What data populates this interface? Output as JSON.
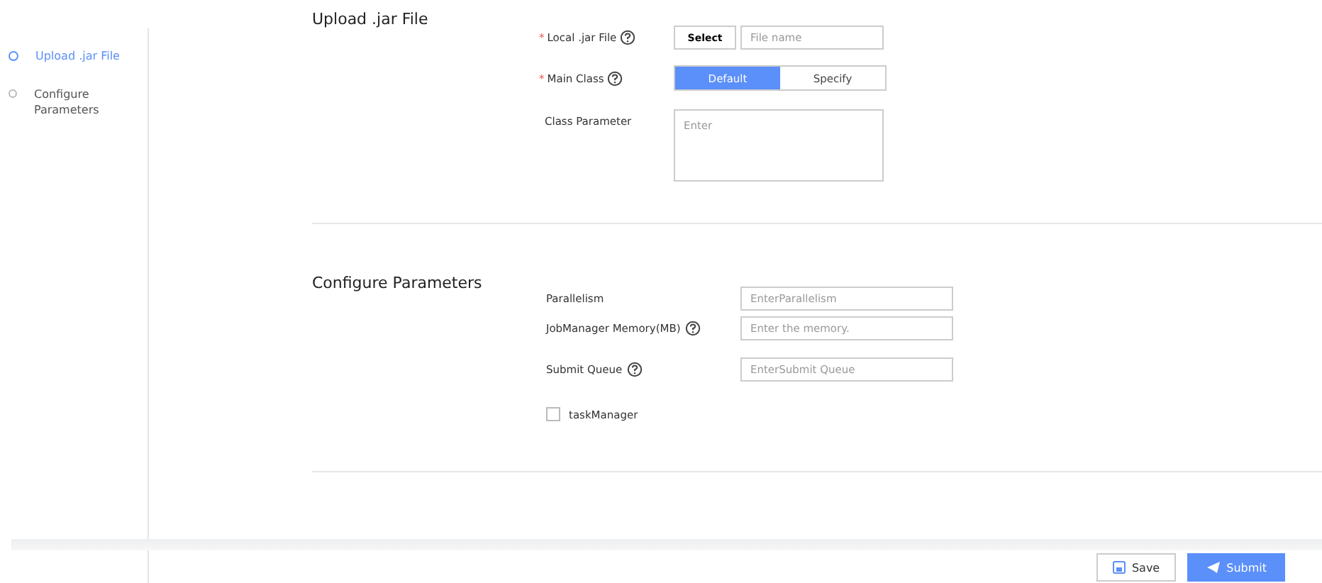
{
  "steps": [
    {
      "label": "Upload .jar File",
      "selected": true
    },
    {
      "label": "Configure Parameters",
      "selected": false
    }
  ],
  "upload": {
    "title": "Upload .jar File",
    "local_jar": {
      "mark": "*",
      "label": "Local .jar File",
      "help": true,
      "button": "Select",
      "placeholder": "File name"
    },
    "main_class": {
      "mark": "*",
      "label": "Main Class",
      "help": true,
      "options": [
        {
          "label": "Default",
          "selected": true
        },
        {
          "label": "Specify",
          "selected": false
        }
      ]
    },
    "class_parameter": {
      "label": "Class Parameter",
      "placeholder": "Enter"
    }
  },
  "configure": {
    "title": "Configure Parameters",
    "fields": [
      {
        "label": "Parallelism",
        "help": false,
        "placeholder": "EnterParallelism"
      },
      {
        "label": "JobManager Memory(MB)",
        "help": true,
        "placeholder": "Enter the memory."
      },
      {
        "label": "Submit Queue",
        "help": true,
        "placeholder": "EnterSubmit Queue"
      }
    ],
    "task_manager": {
      "label": "taskManager",
      "checked": false
    }
  },
  "footer": {
    "buttons": [
      {
        "label": "Save",
        "kind": "save"
      },
      {
        "label": "Submit",
        "kind": "submit"
      }
    ]
  }
}
